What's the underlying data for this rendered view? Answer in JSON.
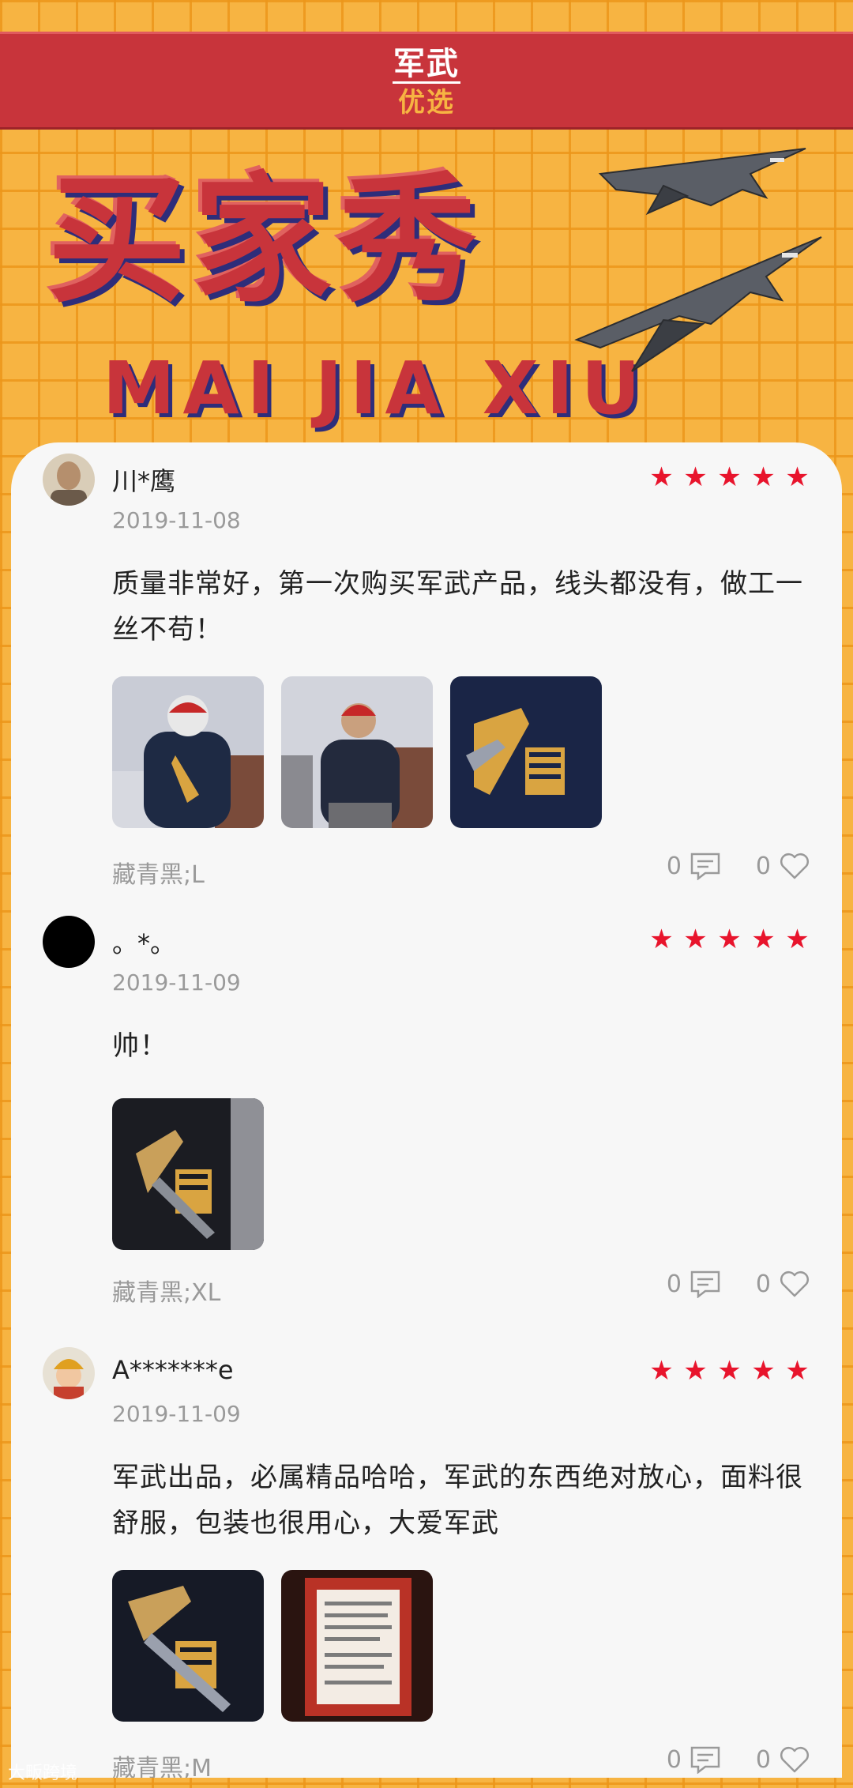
{
  "header": {
    "brand_top": "军武",
    "brand_bottom": "优选",
    "title": "买家秀",
    "pinyin": "MAI JIA XIU"
  },
  "reviews": [
    {
      "username": "川*鹰",
      "date": "2019-11-08",
      "rating": 5,
      "text": "质量非常好，第一次购买军武产品，线头都没有，做工一丝不苟！",
      "photos": [
        "back-view-photo",
        "front-view-photo",
        "print-closeup-photo"
      ],
      "variant": "藏青黑;L",
      "comments": "0",
      "likes": "0"
    },
    {
      "username": "。*。",
      "date": "2019-11-09",
      "rating": 5,
      "text": "帅！",
      "photos": [
        "shirt-print-photo"
      ],
      "variant": "藏青黑;XL",
      "comments": "0",
      "likes": "0"
    },
    {
      "username": "A*******e",
      "date": "2019-11-09",
      "rating": 5,
      "text": "军武出品，必属精品哈哈，军武的东西绝对放心，面料很舒服，包装也很用心，大爱军武",
      "photos": [
        "print-detail-photo",
        "package-card-photo"
      ],
      "variant": "藏青黑;M",
      "comments": "0",
      "likes": "0"
    }
  ],
  "watermark": "大畈跨境",
  "colors": {
    "background": "#f7b442",
    "banner": "#c8343b",
    "star": "#e8142c",
    "card": "#f7f7f7"
  },
  "icons": [
    "star-icon",
    "comment-icon",
    "heart-icon",
    "jet-icon"
  ]
}
